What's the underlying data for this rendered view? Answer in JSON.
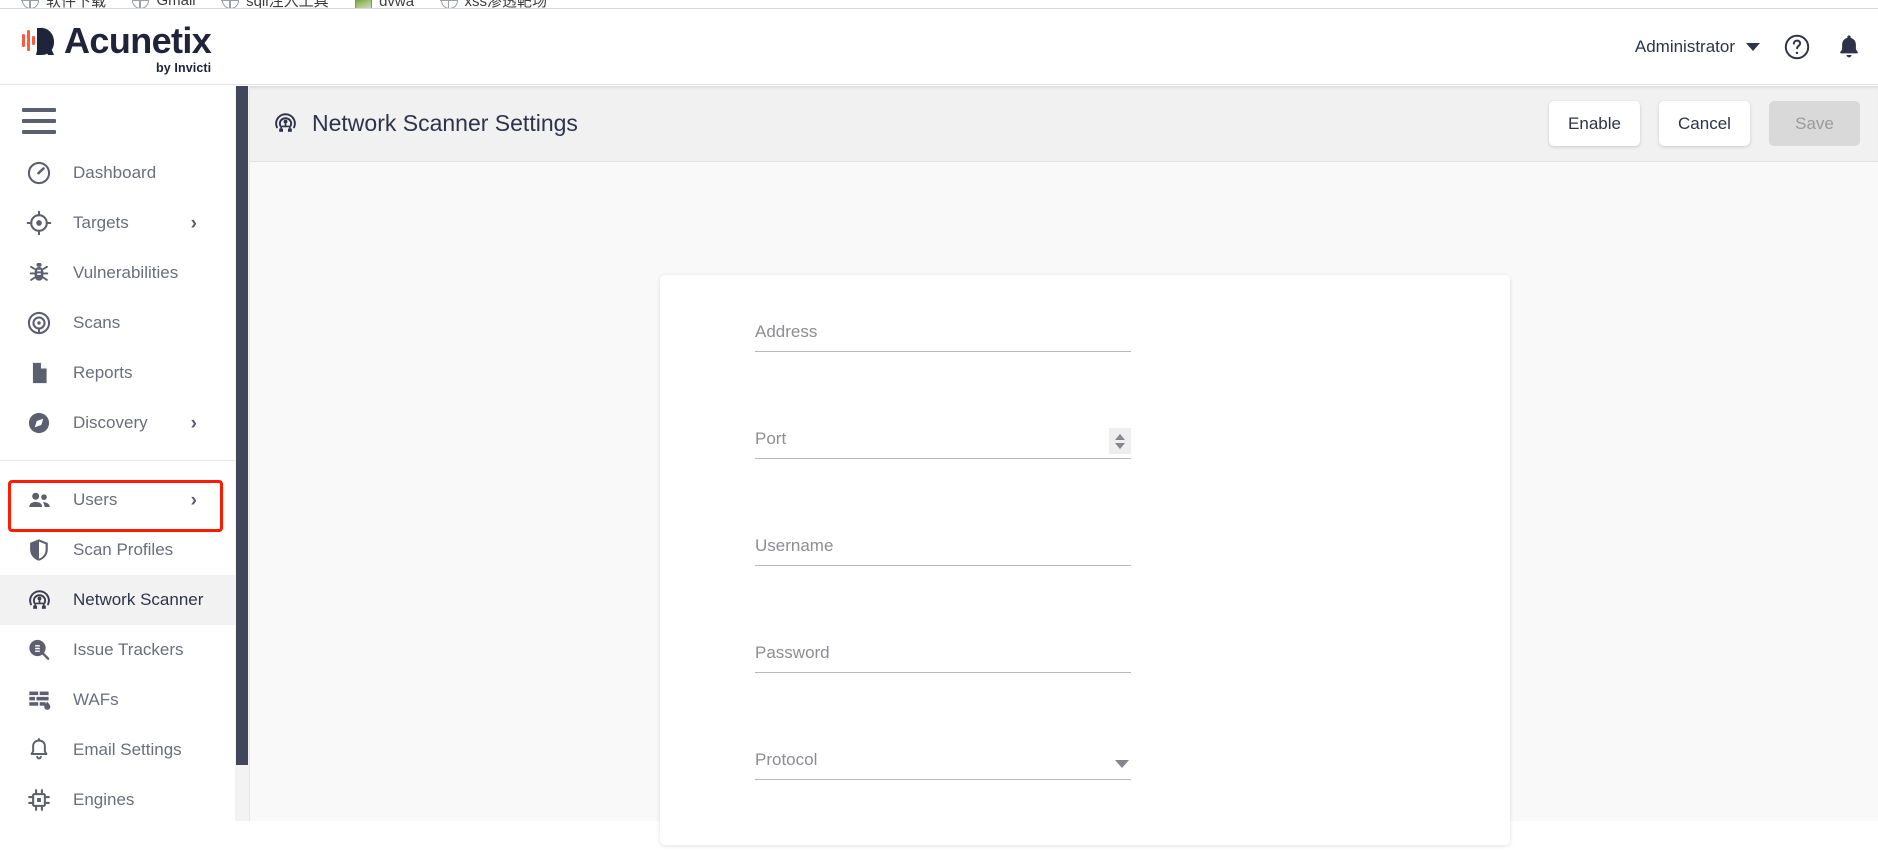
{
  "browser": {
    "bookmarks": [
      {
        "label": "软件下载",
        "icon": "globe-icon"
      },
      {
        "label": "Gmail",
        "icon": "globe-icon"
      },
      {
        "label": "sqli注入工具",
        "icon": "globe-icon"
      },
      {
        "label": "dvwa",
        "icon": "image-icon"
      },
      {
        "label": "xss渗透靶场",
        "icon": "globe-icon"
      }
    ]
  },
  "topbar": {
    "logo_word": "Acunetix",
    "logo_sub": "by Invicti",
    "logo_icon": "acunetix-logo-icon",
    "user_name": "Administrator",
    "help_icon": "help-circle-icon",
    "notifications_icon": "bell-icon",
    "caret_icon": "chevron-down-icon"
  },
  "sidebar": {
    "menu_icon": "hamburger-menu-icon",
    "groups": [
      {
        "items": [
          {
            "label": "Dashboard",
            "icon": "dashboard-gauge-icon",
            "has_chevron": false,
            "active": false
          },
          {
            "label": "Targets",
            "icon": "target-crosshair-icon",
            "has_chevron": true,
            "active": false
          },
          {
            "label": "Vulnerabilities",
            "icon": "bug-icon",
            "has_chevron": false,
            "active": false
          },
          {
            "label": "Scans",
            "icon": "scan-radar-icon",
            "has_chevron": false,
            "active": false
          },
          {
            "label": "Reports",
            "icon": "document-icon",
            "has_chevron": false,
            "active": false
          },
          {
            "label": "Discovery",
            "icon": "compass-icon",
            "has_chevron": true,
            "active": false
          }
        ]
      },
      {
        "items": [
          {
            "label": "Users",
            "icon": "users-icon",
            "has_chevron": true,
            "active": false
          },
          {
            "label": "Scan Profiles",
            "icon": "shield-icon",
            "has_chevron": false,
            "active": false
          },
          {
            "label": "Network Scanner",
            "icon": "network-scanner-icon",
            "has_chevron": false,
            "active": true
          },
          {
            "label": "Issue Trackers",
            "icon": "bug-search-icon",
            "has_chevron": false,
            "active": false
          },
          {
            "label": "WAFs",
            "icon": "firewall-icon",
            "has_chevron": false,
            "active": false
          },
          {
            "label": "Email Settings",
            "icon": "bell-outline-icon",
            "has_chevron": false,
            "active": false
          },
          {
            "label": "Engines",
            "icon": "chip-icon",
            "has_chevron": false,
            "active": false
          }
        ]
      }
    ],
    "chevron_glyph": "›",
    "scrollbar": "sidebar-scrollbar"
  },
  "page": {
    "title": "Network Scanner Settings",
    "title_icon": "network-scanner-icon",
    "actions": [
      {
        "label": "Enable",
        "name": "enable-button",
        "disabled": false
      },
      {
        "label": "Cancel",
        "name": "cancel-button",
        "disabled": false
      },
      {
        "label": "Save",
        "name": "save-button",
        "disabled": true
      }
    ]
  },
  "form": {
    "fields": [
      {
        "label": "Address",
        "value": "",
        "type": "text",
        "name": "address-field"
      },
      {
        "label": "Port",
        "value": "",
        "type": "number",
        "name": "port-field"
      },
      {
        "label": "Username",
        "value": "",
        "type": "text",
        "name": "username-field"
      },
      {
        "label": "Password",
        "value": "",
        "type": "password",
        "name": "password-field"
      },
      {
        "label": "Protocol",
        "value": "",
        "type": "select",
        "name": "protocol-field"
      }
    ]
  },
  "colors": {
    "accent_red": "#ff1a00",
    "brand_dark": "#20243a",
    "page_bg": "#f9f9f9",
    "header_bg": "#f1f1f1",
    "scrollbar": "#43465a"
  }
}
